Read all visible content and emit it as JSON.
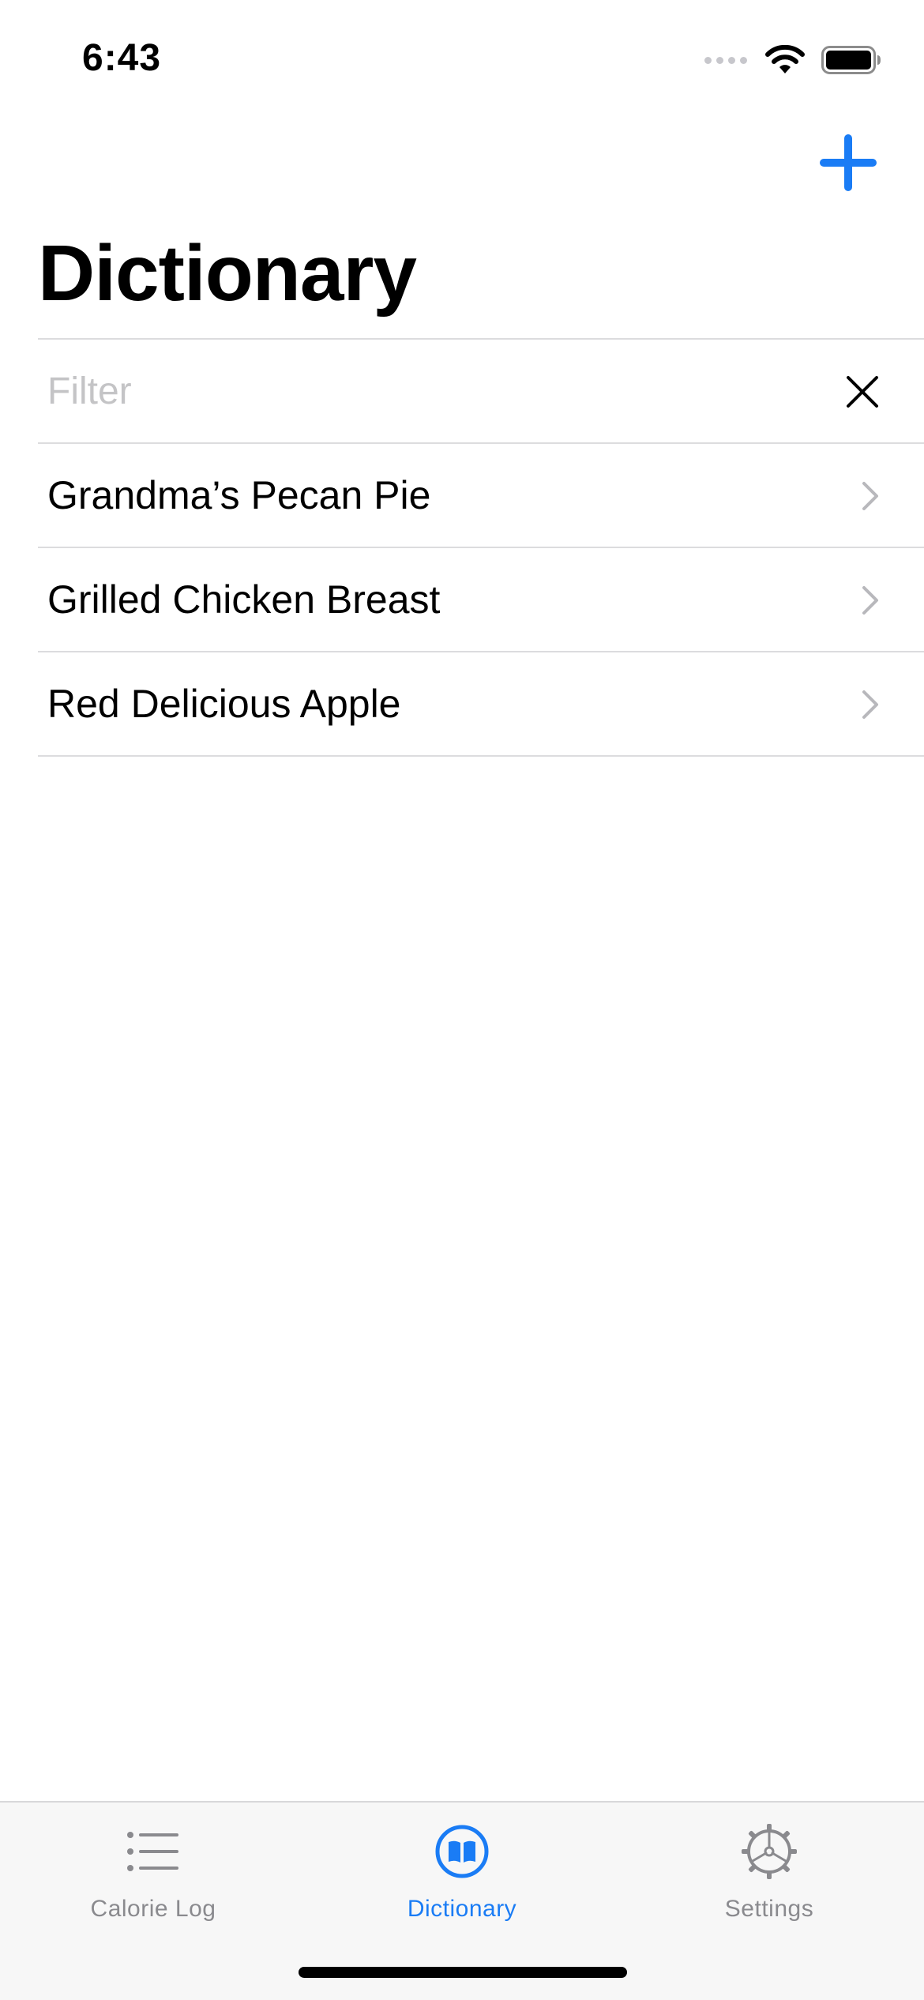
{
  "status_bar": {
    "time": "6:43"
  },
  "nav": {
    "title": "Dictionary",
    "add_icon": "plus-icon"
  },
  "filter": {
    "placeholder": "Filter",
    "value": ""
  },
  "items": [
    {
      "label": "Grandma’s Pecan Pie"
    },
    {
      "label": "Grilled Chicken Breast"
    },
    {
      "label": "Red Delicious Apple"
    }
  ],
  "tabs": [
    {
      "label": "Calorie Log",
      "icon": "list-icon",
      "active": false
    },
    {
      "label": "Dictionary",
      "icon": "book-icon",
      "active": true
    },
    {
      "label": "Settings",
      "icon": "gear-icon",
      "active": false
    }
  ],
  "colors": {
    "accent": "#1a7cf5",
    "inactive": "#8a8a8e",
    "separator": "#dcdcde"
  }
}
